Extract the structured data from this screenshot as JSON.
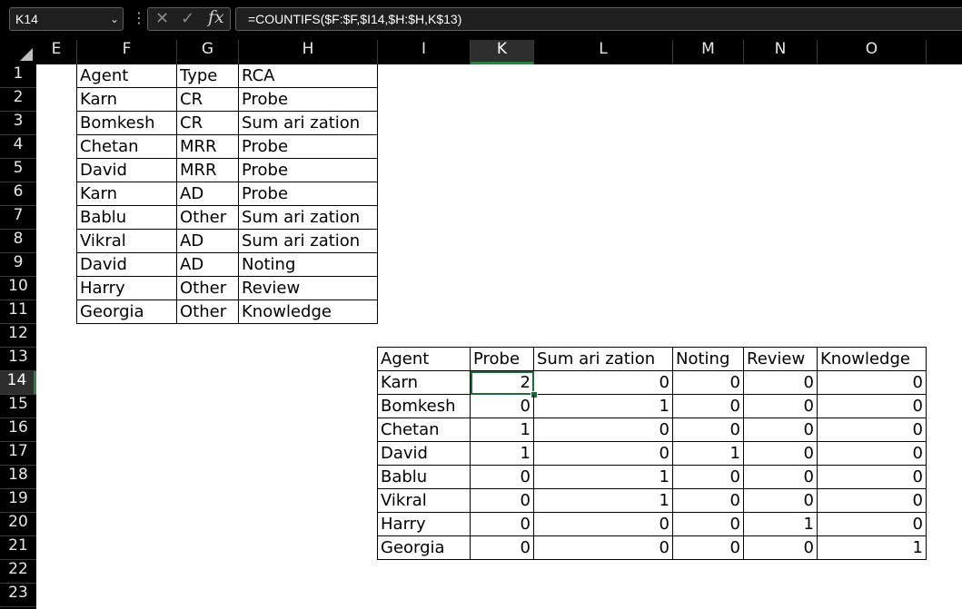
{
  "formula_bar": {
    "name_box": "K14",
    "cancel_icon": "✕",
    "enter_icon": "✓",
    "fx_label": "fx",
    "formula": "=COUNTIFS($F:$F,$I14,$H:$H,K$13)"
  },
  "columns": [
    "E",
    "F",
    "G",
    "H",
    "I",
    "K",
    "L",
    "M",
    "N",
    "O"
  ],
  "rows": [
    "1",
    "2",
    "3",
    "4",
    "5",
    "6",
    "7",
    "8",
    "9",
    "10",
    "11",
    "12",
    "13",
    "14",
    "15",
    "16",
    "17",
    "18",
    "19",
    "20",
    "21",
    "22",
    "23"
  ],
  "selected_column": "K",
  "selected_row": "14",
  "source_table": {
    "header": [
      "Agent",
      "Type",
      "RCA"
    ],
    "rows": [
      [
        "Karn",
        "CR",
        "Probe"
      ],
      [
        "Bomkesh",
        "CR",
        "Sum ari zation"
      ],
      [
        "Chetan",
        "MRR",
        "Probe"
      ],
      [
        "David",
        "MRR",
        "Probe"
      ],
      [
        "Karn",
        "AD",
        "Probe"
      ],
      [
        "Bablu",
        "Other",
        "Sum ari zation"
      ],
      [
        "Vikral",
        "AD",
        "Sum ari zation"
      ],
      [
        "David",
        "AD",
        "Noting"
      ],
      [
        "Harry",
        "Other",
        "Review"
      ],
      [
        "Georgia",
        "Other",
        "Knowledge"
      ]
    ]
  },
  "summary_table": {
    "header": [
      "Agent",
      "Probe",
      "Sum ari zation",
      "Noting",
      "Review",
      "Knowledge"
    ],
    "rows": [
      [
        "Karn",
        "2",
        "0",
        "0",
        "0",
        "0"
      ],
      [
        "Bomkesh",
        "0",
        "1",
        "0",
        "0",
        "0"
      ],
      [
        "Chetan",
        "1",
        "0",
        "0",
        "0",
        "0"
      ],
      [
        "David",
        "1",
        "0",
        "1",
        "0",
        "0"
      ],
      [
        "Bablu",
        "0",
        "1",
        "0",
        "0",
        "0"
      ],
      [
        "Vikral",
        "0",
        "1",
        "0",
        "0",
        "0"
      ],
      [
        "Harry",
        "0",
        "0",
        "0",
        "1",
        "0"
      ],
      [
        "Georgia",
        "0",
        "0",
        "0",
        "0",
        "1"
      ]
    ]
  },
  "colors": {
    "selection_accent": "#2e7d42",
    "header_bg": "#000000",
    "sheet_bg": "#ffffff"
  }
}
